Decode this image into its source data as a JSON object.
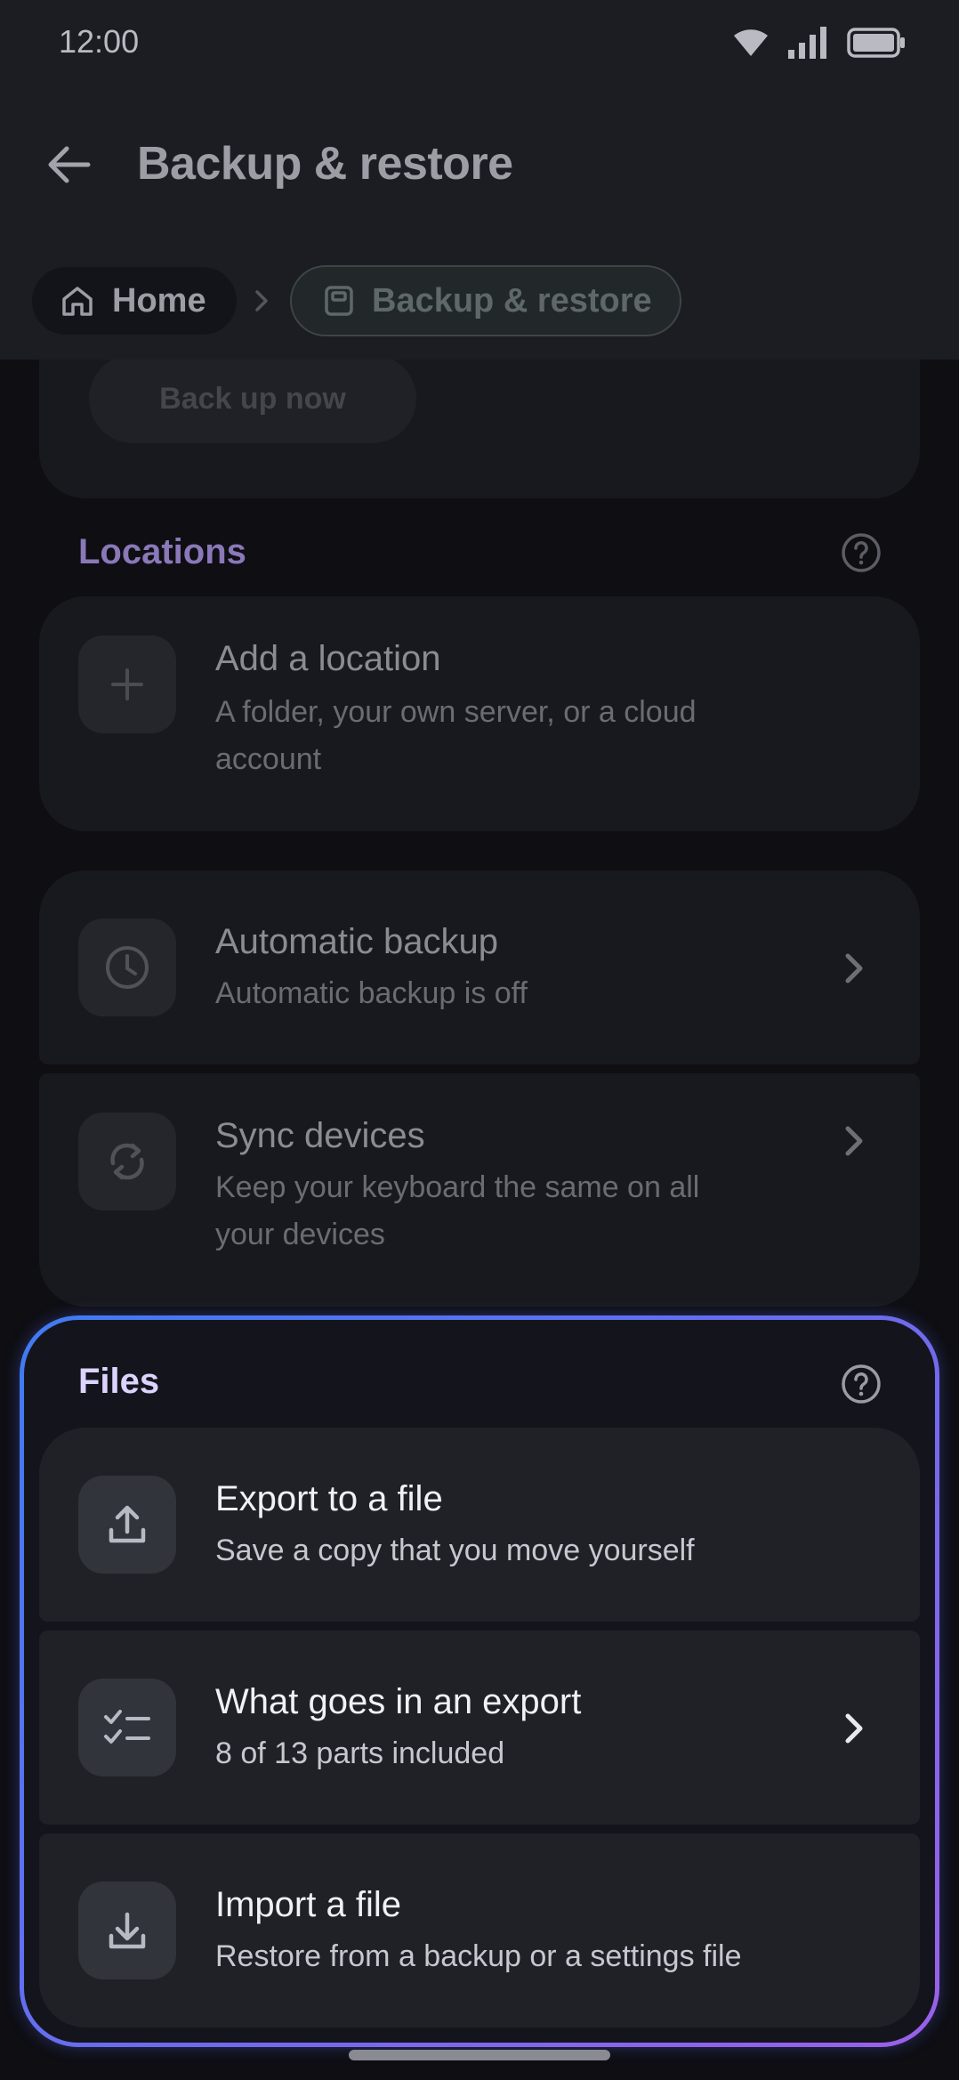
{
  "status_bar": {
    "time": "12:00"
  },
  "header": {
    "title": "Backup & restore"
  },
  "breadcrumb": {
    "home": "Home",
    "current": "Backup & restore"
  },
  "backup_card": {
    "button_label": "Back up now"
  },
  "locations": {
    "title": "Locations",
    "add": {
      "title": "Add a location",
      "subtitle_line1": "A folder, your own server, or a cloud",
      "subtitle_line2": "account"
    }
  },
  "settings": {
    "automatic": {
      "title": "Automatic backup",
      "subtitle": "Automatic backup is off"
    },
    "sync": {
      "title": "Sync devices",
      "subtitle_line1": "Keep your keyboard the same on all",
      "subtitle_line2": "your devices"
    }
  },
  "files": {
    "title": "Files",
    "export": {
      "title": "Export to a file",
      "subtitle": "Save a copy that you move yourself"
    },
    "contents": {
      "title": "What goes in an export",
      "subtitle": "8 of 13 parts included"
    },
    "import": {
      "title": "Import a file",
      "subtitle": "Restore from a backup or a settings file"
    }
  },
  "colors": {
    "locations_accent": "#8a78b8",
    "files_accent": "#dcd3ff",
    "frame_start": "#3f7bf2",
    "frame_end": "#9b60ea"
  }
}
